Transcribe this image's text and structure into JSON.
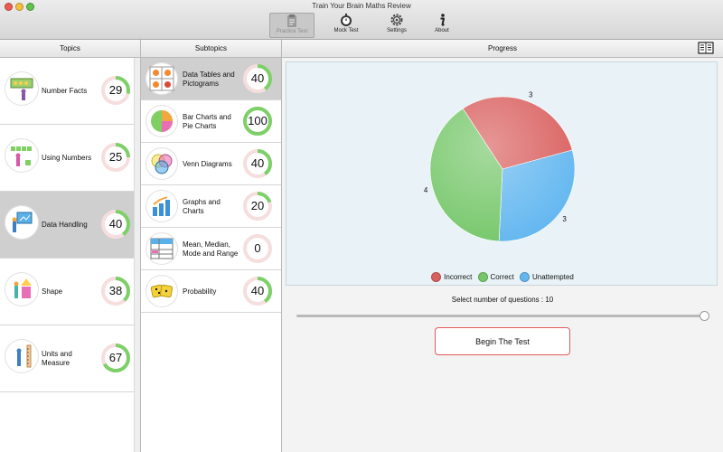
{
  "window": {
    "title": "Train Your Brain Maths Review"
  },
  "toolbar": [
    {
      "label": "Practice Test",
      "icon": "clipboard-icon",
      "active": true
    },
    {
      "label": "Mock Test",
      "icon": "stopwatch-icon",
      "active": false
    },
    {
      "label": "Settings",
      "icon": "gear-icon",
      "active": false
    },
    {
      "label": "About",
      "icon": "info-icon",
      "active": false
    }
  ],
  "topics": {
    "header": "Topics",
    "items": [
      {
        "label": "Number Facts",
        "score": "29",
        "progress": 0.29,
        "selected": false,
        "icon": "abacus-teacher-icon"
      },
      {
        "label": "Using Numbers",
        "score": "25",
        "progress": 0.25,
        "selected": false,
        "icon": "number-blocks-icon"
      },
      {
        "label": "Data Handling",
        "score": "40",
        "progress": 0.4,
        "selected": true,
        "icon": "presentation-board-icon"
      },
      {
        "label": "Shape",
        "score": "38",
        "progress": 0.38,
        "selected": false,
        "icon": "shapes-person-icon"
      },
      {
        "label": "Units and Measure",
        "score": "67",
        "progress": 0.67,
        "selected": false,
        "icon": "measuring-person-icon"
      }
    ]
  },
  "subtopics": {
    "header": "Subtopics",
    "items": [
      {
        "label": "Data Tables and Pictograms",
        "score": "40",
        "progress": 0.4,
        "selected": true,
        "icon": "pictogram-grid-icon"
      },
      {
        "label": "Bar Charts and Pie Charts",
        "score": "100",
        "progress": 1.0,
        "selected": false,
        "icon": "pie-chart-icon"
      },
      {
        "label": "Venn Diagrams",
        "score": "40",
        "progress": 0.4,
        "selected": false,
        "icon": "venn-diagram-icon"
      },
      {
        "label": "Graphs and Charts",
        "score": "20",
        "progress": 0.2,
        "selected": false,
        "icon": "bar-graph-icon"
      },
      {
        "label": "Mean, Median, Mode and Range",
        "score": "0",
        "progress": 0.0,
        "selected": false,
        "icon": "data-table-icon"
      },
      {
        "label": "Probability",
        "score": "40",
        "progress": 0.4,
        "selected": false,
        "icon": "dice-icon"
      }
    ]
  },
  "progress": {
    "header": "Progress",
    "select_label": "Select number of questions : 10",
    "slider_value": 1.0,
    "begin_button": "Begin The Test"
  },
  "colors": {
    "incorrect": "#d9605f",
    "correct": "#76c76a",
    "unattempted": "#63b7f0",
    "ring_fill": "#7dd068",
    "ring_track": "#f6dede"
  },
  "chart_data": {
    "type": "pie",
    "slices": [
      {
        "name": "Incorrect",
        "value": 3
      },
      {
        "name": "Unattempted",
        "value": 3
      },
      {
        "name": "Correct",
        "value": 4
      }
    ],
    "data_labels": [
      "3",
      "3",
      "4"
    ],
    "legend": [
      "Incorrect",
      "Correct",
      "Unattempted"
    ],
    "legend_position": "bottom"
  }
}
